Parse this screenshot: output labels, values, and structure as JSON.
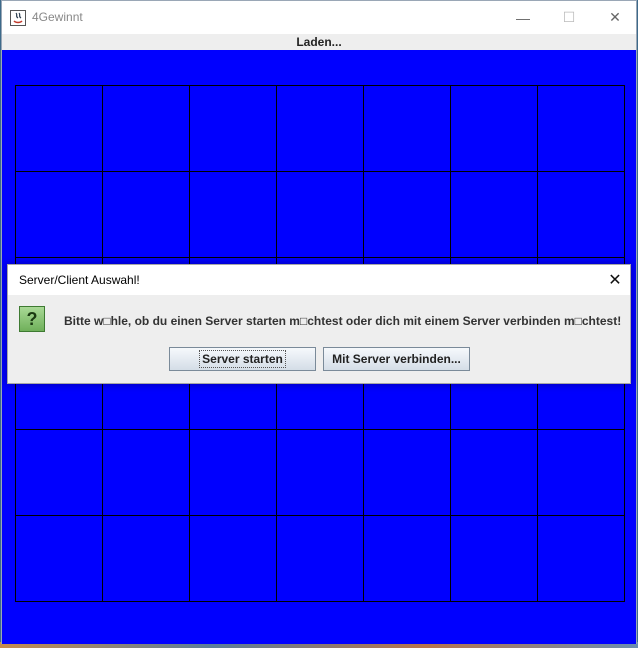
{
  "window": {
    "title": "4Gewinnt",
    "minimize_glyph": "—",
    "maximize_glyph": "☐",
    "close_glyph": "✕"
  },
  "menubar": {
    "status": "Laden..."
  },
  "board": {
    "rows": 6,
    "columns": 7,
    "background": "#0000ff",
    "line_color": "#000000"
  },
  "dialog": {
    "title": "Server/Client Auswahl!",
    "close_glyph": "✕",
    "icon": "question-icon",
    "icon_glyph": "?",
    "message": "Bitte w□hle, ob du einen Server starten m□chtest oder dich mit einem Server verbinden m□chtest!",
    "buttons": {
      "server_start": "Server starten",
      "connect": "Mit Server verbinden..."
    }
  }
}
